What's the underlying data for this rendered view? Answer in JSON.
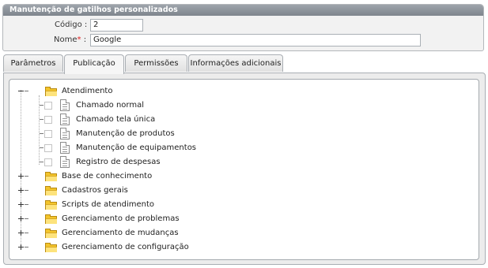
{
  "panel": {
    "title": "Manutenção de gatilhos personalizados",
    "codigo_label": "Código :",
    "codigo_value": "2",
    "nome_label": "Nome",
    "nome_required": "*",
    "nome_colon": ":",
    "nome_value": "Google"
  },
  "tabs": [
    {
      "label": "Parâmetros",
      "active": false
    },
    {
      "label": "Publicação",
      "active": true
    },
    {
      "label": "Permissões",
      "active": false
    },
    {
      "label": "Informações adicionais",
      "active": false
    }
  ],
  "tree": {
    "expanded": {
      "label": "Atendimento",
      "children": [
        {
          "label": "Chamado normal",
          "checked": false
        },
        {
          "label": "Chamado tela única",
          "checked": false
        },
        {
          "label": "Manutenção de produtos",
          "checked": false
        },
        {
          "label": "Manutenção de equipamentos",
          "checked": false
        },
        {
          "label": "Registro de despesas",
          "checked": false
        }
      ]
    },
    "collapsed": [
      {
        "label": "Base de conhecimento"
      },
      {
        "label": "Cadastros gerais"
      },
      {
        "label": "Scripts de atendimento"
      },
      {
        "label": "Gerenciamento de problemas"
      },
      {
        "label": "Gerenciamento de mudanças"
      },
      {
        "label": "Gerenciamento de configuração"
      }
    ]
  },
  "colors": {
    "header": "#8a9096",
    "folder": "#f3c42b",
    "required": "#e02020"
  }
}
